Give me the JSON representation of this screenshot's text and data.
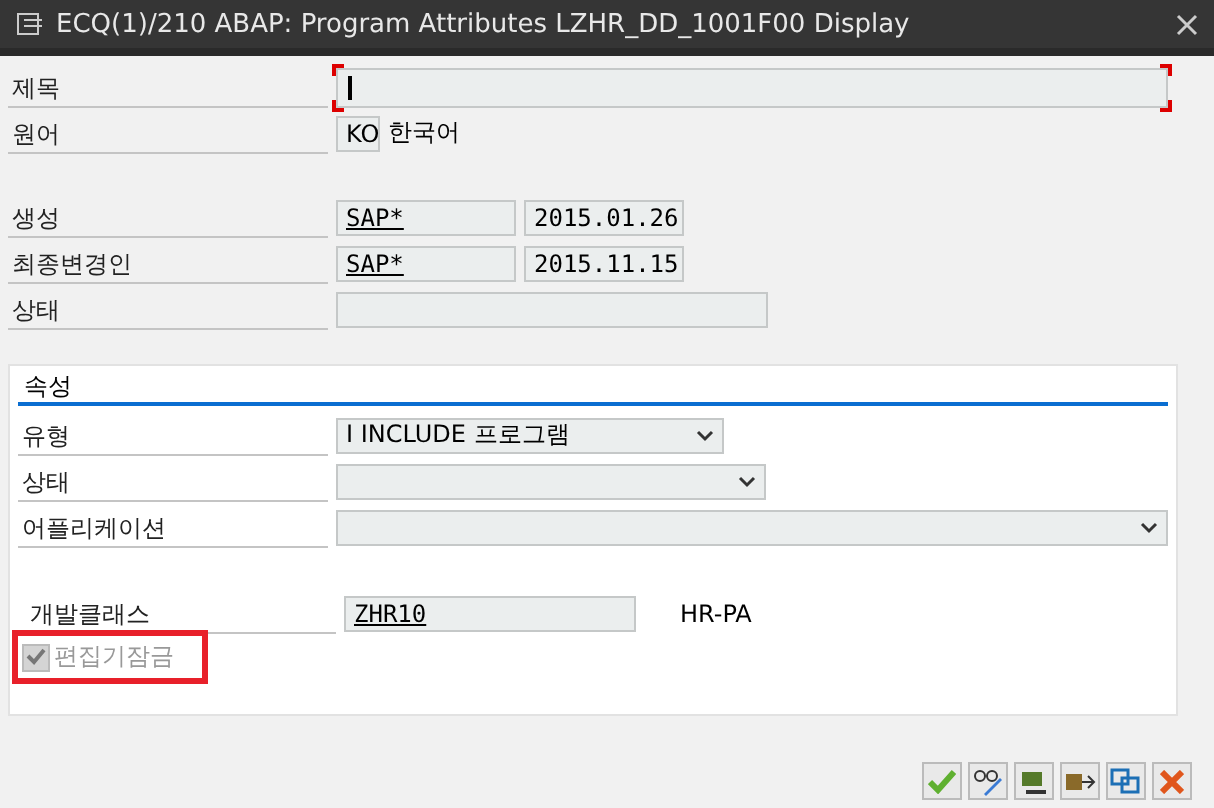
{
  "window": {
    "title": "ECQ(1)/210 ABAP: Program Attributes LZHR_DD_1001F00 Display"
  },
  "header_fields": [
    {
      "label": "제목",
      "kind": "title"
    },
    {
      "label": "원어",
      "kind": "lang",
      "value": "KO",
      "description": "한국어"
    }
  ],
  "info_fields": [
    {
      "label": "생성",
      "kind": "pair",
      "value": "SAP*",
      "date": "2015.01.26"
    },
    {
      "label": "최종변경인",
      "kind": "pair",
      "value": "SAP*",
      "date": "2015.11.15"
    },
    {
      "label": "상태",
      "kind": "empty"
    }
  ],
  "attributes": {
    "title": "속성",
    "fields": [
      {
        "label": "유형",
        "kind": "short",
        "value": "I INCLUDE 프로그램"
      },
      {
        "label": "상태",
        "kind": "medium"
      },
      {
        "label": "어플리케이션",
        "kind": "long"
      }
    ],
    "package": {
      "label": "개발클래스",
      "value": "ZHR10",
      "description": "HR-PA"
    },
    "edit_lock": {
      "label": "편집기잠금",
      "checked": true,
      "disabled": true,
      "highlighted": true
    }
  },
  "buttons": [
    {
      "kind": "confirm"
    },
    {
      "kind": "display-change"
    },
    {
      "kind": "where-used"
    },
    {
      "kind": "transfer"
    },
    {
      "kind": "windows"
    },
    {
      "kind": "cancel"
    }
  ]
}
